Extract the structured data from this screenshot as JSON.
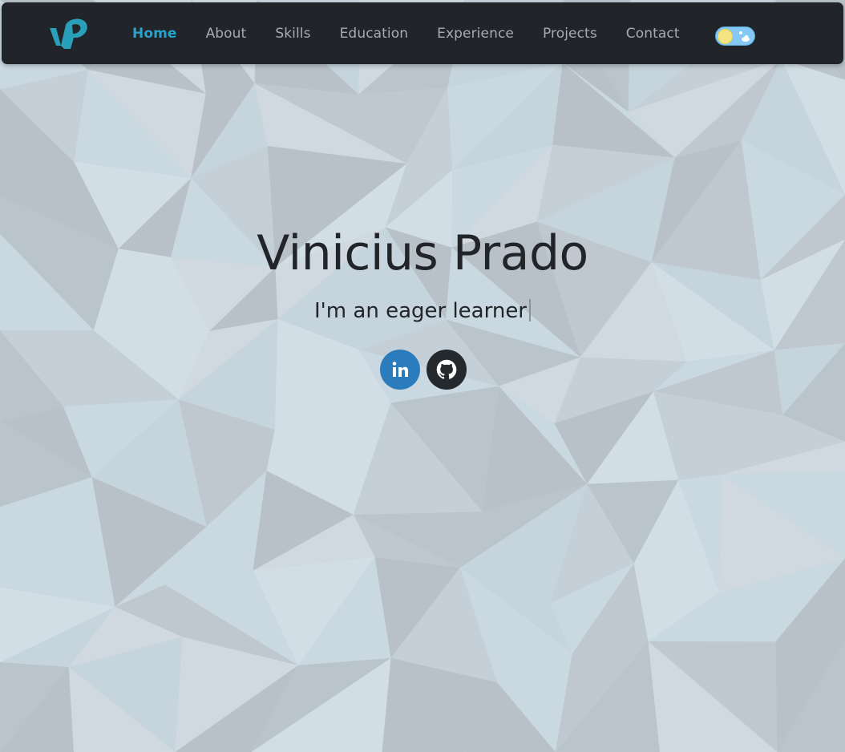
{
  "nav": {
    "logo_alt": "VP logo",
    "items": [
      {
        "label": "Home",
        "active": true
      },
      {
        "label": "About",
        "active": false
      },
      {
        "label": "Skills",
        "active": false
      },
      {
        "label": "Education",
        "active": false
      },
      {
        "label": "Experience",
        "active": false
      },
      {
        "label": "Projects",
        "active": false
      },
      {
        "label": "Contact",
        "active": false
      }
    ],
    "theme_toggle": {
      "mode": "light",
      "icons": [
        "sun-icon",
        "cloud-icon"
      ]
    }
  },
  "hero": {
    "name": "Vinicius Prado",
    "tagline": "I'm an eager learner"
  },
  "social": [
    {
      "name": "linkedin",
      "icon": "linkedin-icon",
      "color": "#2b7cbd"
    },
    {
      "name": "github",
      "icon": "github-icon",
      "color": "#24292e"
    }
  ],
  "colors": {
    "accent": "#2aa1c8",
    "navbar": "#212529",
    "nav_text": "#a7acb1",
    "background": "#c8d7e0"
  }
}
